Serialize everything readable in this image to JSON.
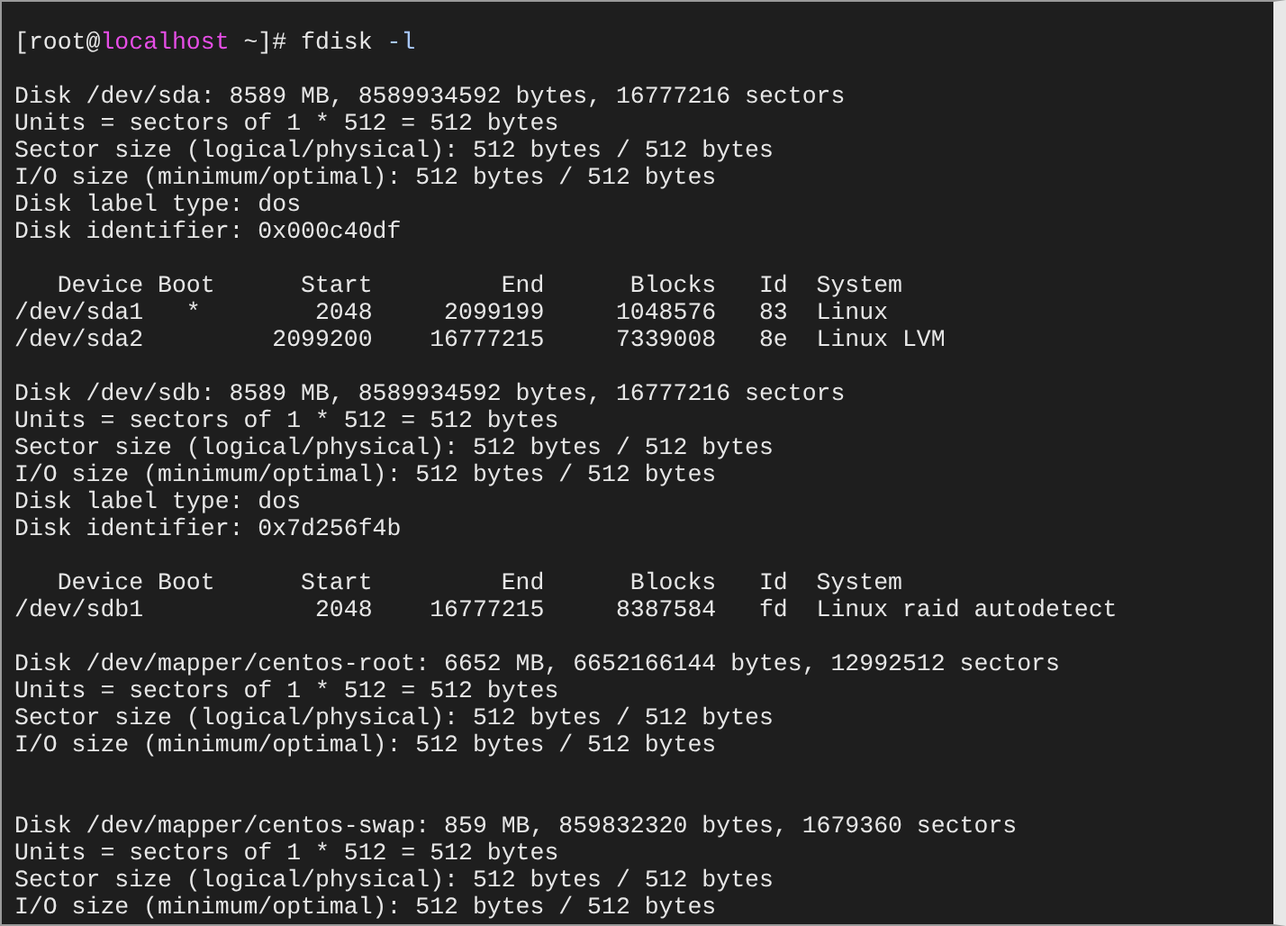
{
  "prompt": [
    {
      "kind": "plain",
      "text": "[root@"
    },
    {
      "kind": "host",
      "text": "localhost"
    },
    {
      "kind": "plain",
      "text": " ~]# fdisk "
    },
    {
      "kind": "option",
      "text": "-l"
    }
  ],
  "lines": [
    {
      "kind": "blank"
    },
    {
      "kind": "text",
      "text": "Disk /dev/sda: 8589 MB, 8589934592 bytes, 16777216 sectors"
    },
    {
      "kind": "text",
      "text": "Units = sectors of 1 * 512 = 512 bytes"
    },
    {
      "kind": "text",
      "text": "Sector size (logical/physical): 512 bytes / 512 bytes"
    },
    {
      "kind": "text",
      "text": "I/O size (minimum/optimal): 512 bytes / 512 bytes"
    },
    {
      "kind": "text",
      "text": "Disk label type: dos"
    },
    {
      "kind": "text",
      "text": "Disk identifier: 0x000c40df"
    },
    {
      "kind": "blank"
    },
    {
      "kind": "text",
      "text": "   Device Boot      Start         End      Blocks   Id  System"
    },
    {
      "kind": "text",
      "text": "/dev/sda1   *        2048     2099199     1048576   83  Linux"
    },
    {
      "kind": "text",
      "text": "/dev/sda2         2099200    16777215     7339008   8e  Linux LVM"
    },
    {
      "kind": "blank"
    },
    {
      "kind": "text",
      "text": "Disk /dev/sdb: 8589 MB, 8589934592 bytes, 16777216 sectors"
    },
    {
      "kind": "text",
      "text": "Units = sectors of 1 * 512 = 512 bytes"
    },
    {
      "kind": "text",
      "text": "Sector size (logical/physical): 512 bytes / 512 bytes"
    },
    {
      "kind": "text",
      "text": "I/O size (minimum/optimal): 512 bytes / 512 bytes"
    },
    {
      "kind": "text",
      "text": "Disk label type: dos"
    },
    {
      "kind": "text",
      "text": "Disk identifier: 0x7d256f4b"
    },
    {
      "kind": "blank"
    },
    {
      "kind": "text",
      "text": "   Device Boot      Start         End      Blocks   Id  System"
    },
    {
      "kind": "text",
      "text": "/dev/sdb1            2048    16777215     8387584   fd  Linux raid autodetect"
    },
    {
      "kind": "blank"
    },
    {
      "kind": "text",
      "text": "Disk /dev/mapper/centos-root: 6652 MB, 6652166144 bytes, 12992512 sectors"
    },
    {
      "kind": "text",
      "text": "Units = sectors of 1 * 512 = 512 bytes"
    },
    {
      "kind": "text",
      "text": "Sector size (logical/physical): 512 bytes / 512 bytes"
    },
    {
      "kind": "text",
      "text": "I/O size (minimum/optimal): 512 bytes / 512 bytes"
    },
    {
      "kind": "blank"
    },
    {
      "kind": "blank"
    },
    {
      "kind": "text",
      "text": "Disk /dev/mapper/centos-swap: 859 MB, 859832320 bytes, 1679360 sectors"
    },
    {
      "kind": "text",
      "text": "Units = sectors of 1 * 512 = 512 bytes"
    },
    {
      "kind": "text",
      "text": "Sector size (logical/physical): 512 bytes / 512 bytes"
    },
    {
      "kind": "text",
      "text": "I/O size (minimum/optimal): 512 bytes / 512 bytes"
    }
  ]
}
